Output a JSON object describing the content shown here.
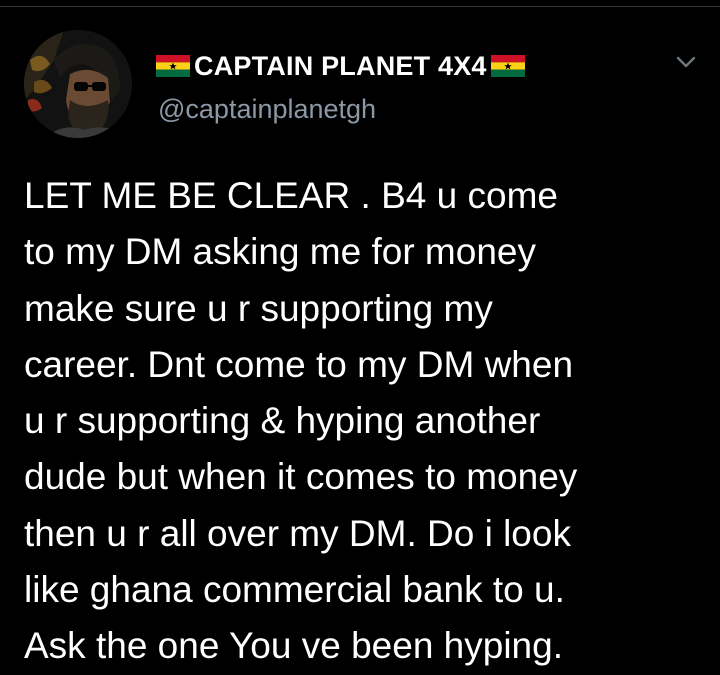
{
  "author": {
    "display_name": "CAPTAIN PLANET 4X4",
    "handle": "@captainplanetgh",
    "name_prefix_icon": "ghana-flag-icon",
    "name_suffix_icon": "ghana-flag-icon",
    "avatar_icon": "avatar-photo"
  },
  "menu": {
    "icon": "chevron-down-icon"
  },
  "tweet": {
    "lines": [
      "LET ME BE CLEAR . B4 u come",
      "to my DM asking me for money",
      "make sure u r supporting my",
      "career. Dnt come to my DM when",
      "u r supporting & hyping another",
      "dude but when it comes to money",
      "then u r all over my DM. Do i look",
      "like ghana commercial bank to u.",
      "Ask the one You ve been hyping."
    ]
  },
  "colors": {
    "background": "#000000",
    "text": "#ffffff",
    "secondary_text": "#8b98a5",
    "flag_red": "#ce1126",
    "flag_gold": "#fcd116",
    "flag_green": "#006b3f"
  }
}
